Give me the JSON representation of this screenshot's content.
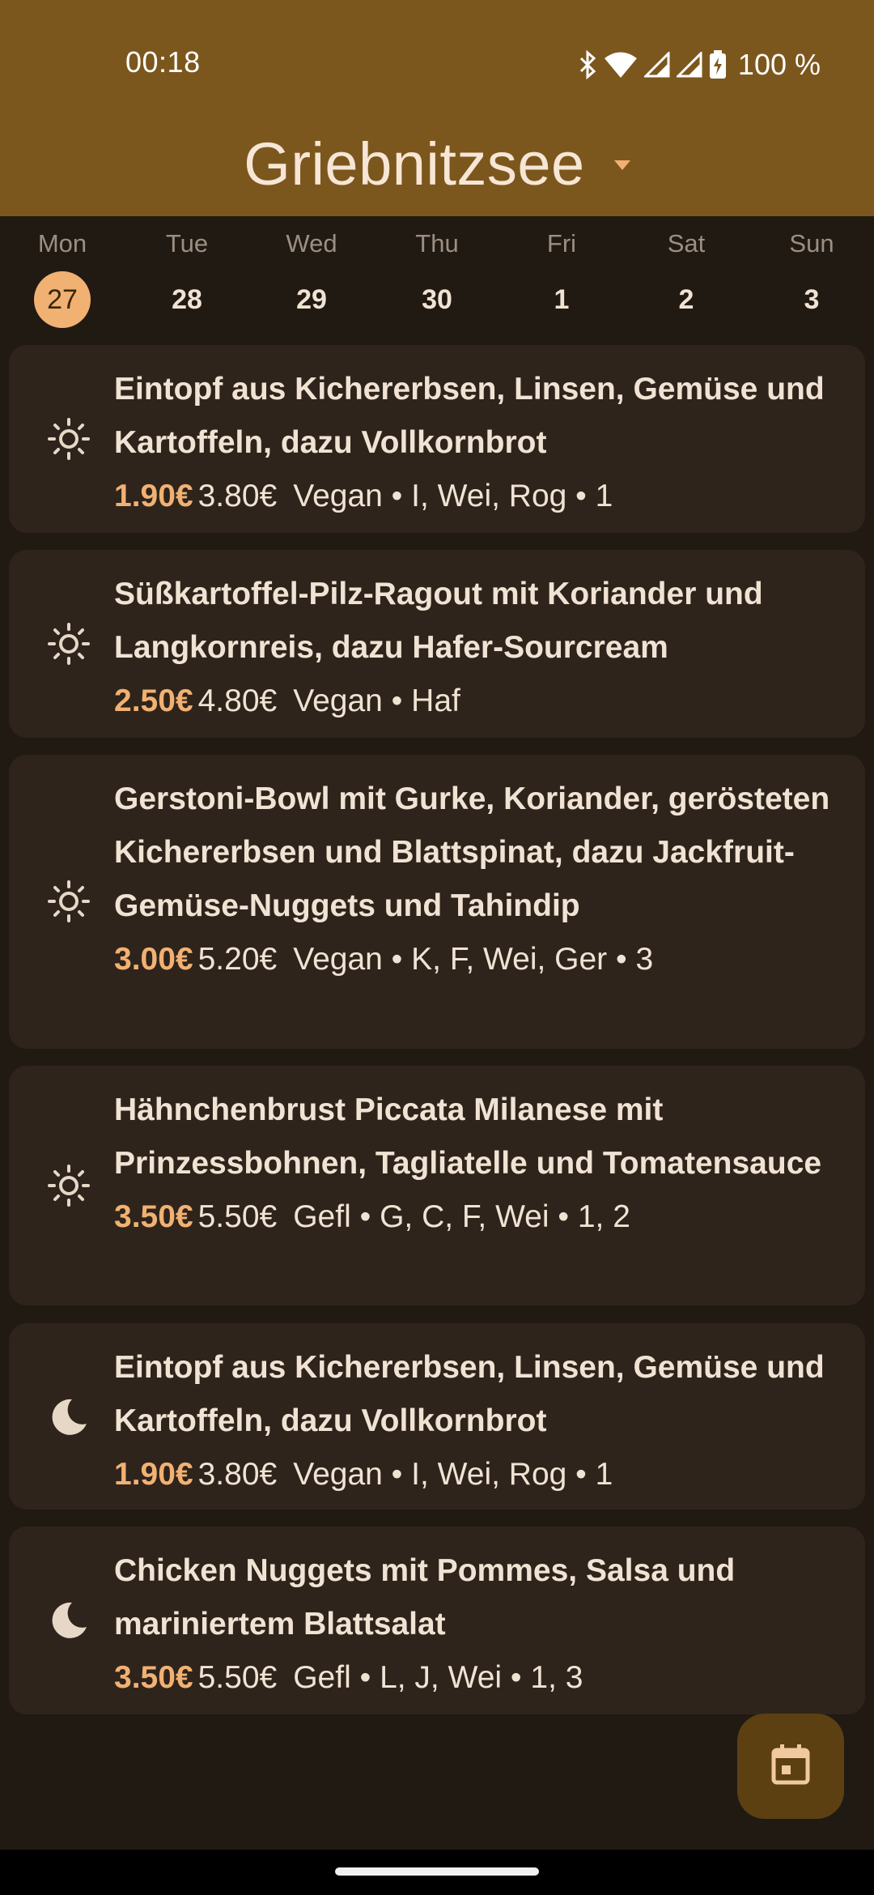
{
  "status_bar": {
    "time": "00:18",
    "battery": "100 %",
    "icons": [
      "bluetooth-icon",
      "wifi-icon",
      "signal-icon",
      "signal-icon",
      "battery-charging-icon"
    ]
  },
  "header": {
    "title": "Griebnitzsee",
    "dropdown_icon": "caret-down-icon",
    "background_color": "#7c571d"
  },
  "week": [
    {
      "name": "Mon",
      "date": "27",
      "selected": true
    },
    {
      "name": "Tue",
      "date": "28",
      "selected": false
    },
    {
      "name": "Wed",
      "date": "29",
      "selected": false
    },
    {
      "name": "Thu",
      "date": "30",
      "selected": false
    },
    {
      "name": "Fri",
      "date": "1",
      "selected": false
    },
    {
      "name": "Sat",
      "date": "2",
      "selected": false
    },
    {
      "name": "Sun",
      "date": "3",
      "selected": false
    }
  ],
  "meals": [
    {
      "time_icon": "sun-icon",
      "name": "Eintopf aus Kichererbsen, Linsen, Gemüse und Kartoffeln, dazu Vollkornbrot",
      "price_student": "1.90€",
      "price_other": "3.80€",
      "tags": "Vegan • I, Wei, Rog • 1"
    },
    {
      "time_icon": "sun-icon",
      "name": "Süßkartoffel-Pilz-Ragout mit Koriander und Langkornreis, dazu Hafer-Sourcream",
      "price_student": "2.50€",
      "price_other": "4.80€",
      "tags": "Vegan • Haf"
    },
    {
      "time_icon": "sun-icon",
      "name": "Gerstoni-Bowl mit Gurke, Koriander, gerösteten Kichererbsen und Blattspinat, dazu Jackfruit-Gemüse-Nuggets und Tahindip",
      "price_student": "3.00€",
      "price_other": "5.20€",
      "tags": "Vegan • K, F, Wei, Ger • 3"
    },
    {
      "time_icon": "sun-icon",
      "name": "Hähnchenbrust Piccata Milanese mit Prinzessbohnen, Tagliatelle und Tomatensauce",
      "price_student": "3.50€",
      "price_other": "5.50€",
      "tags": "Gefl • G, C, F, Wei • 1, 2"
    },
    {
      "time_icon": "moon-icon",
      "name": "Eintopf aus Kichererbsen, Linsen, Gemüse und Kartoffeln, dazu Vollkornbrot",
      "price_student": "1.90€",
      "price_other": "3.80€",
      "tags": "Vegan • I, Wei, Rog • 1"
    },
    {
      "time_icon": "moon-icon",
      "name": "Chicken Nuggets mit Pommes, Salsa und mariniertem Blattsalat",
      "price_student": "3.50€",
      "price_other": "5.50€",
      "tags": "Gefl • L, J, Wei • 1, 3"
    }
  ],
  "fab": {
    "icon": "calendar-icon"
  },
  "colors": {
    "accent": "#f1b173",
    "card": "#2e241b",
    "background": "#211a13"
  }
}
